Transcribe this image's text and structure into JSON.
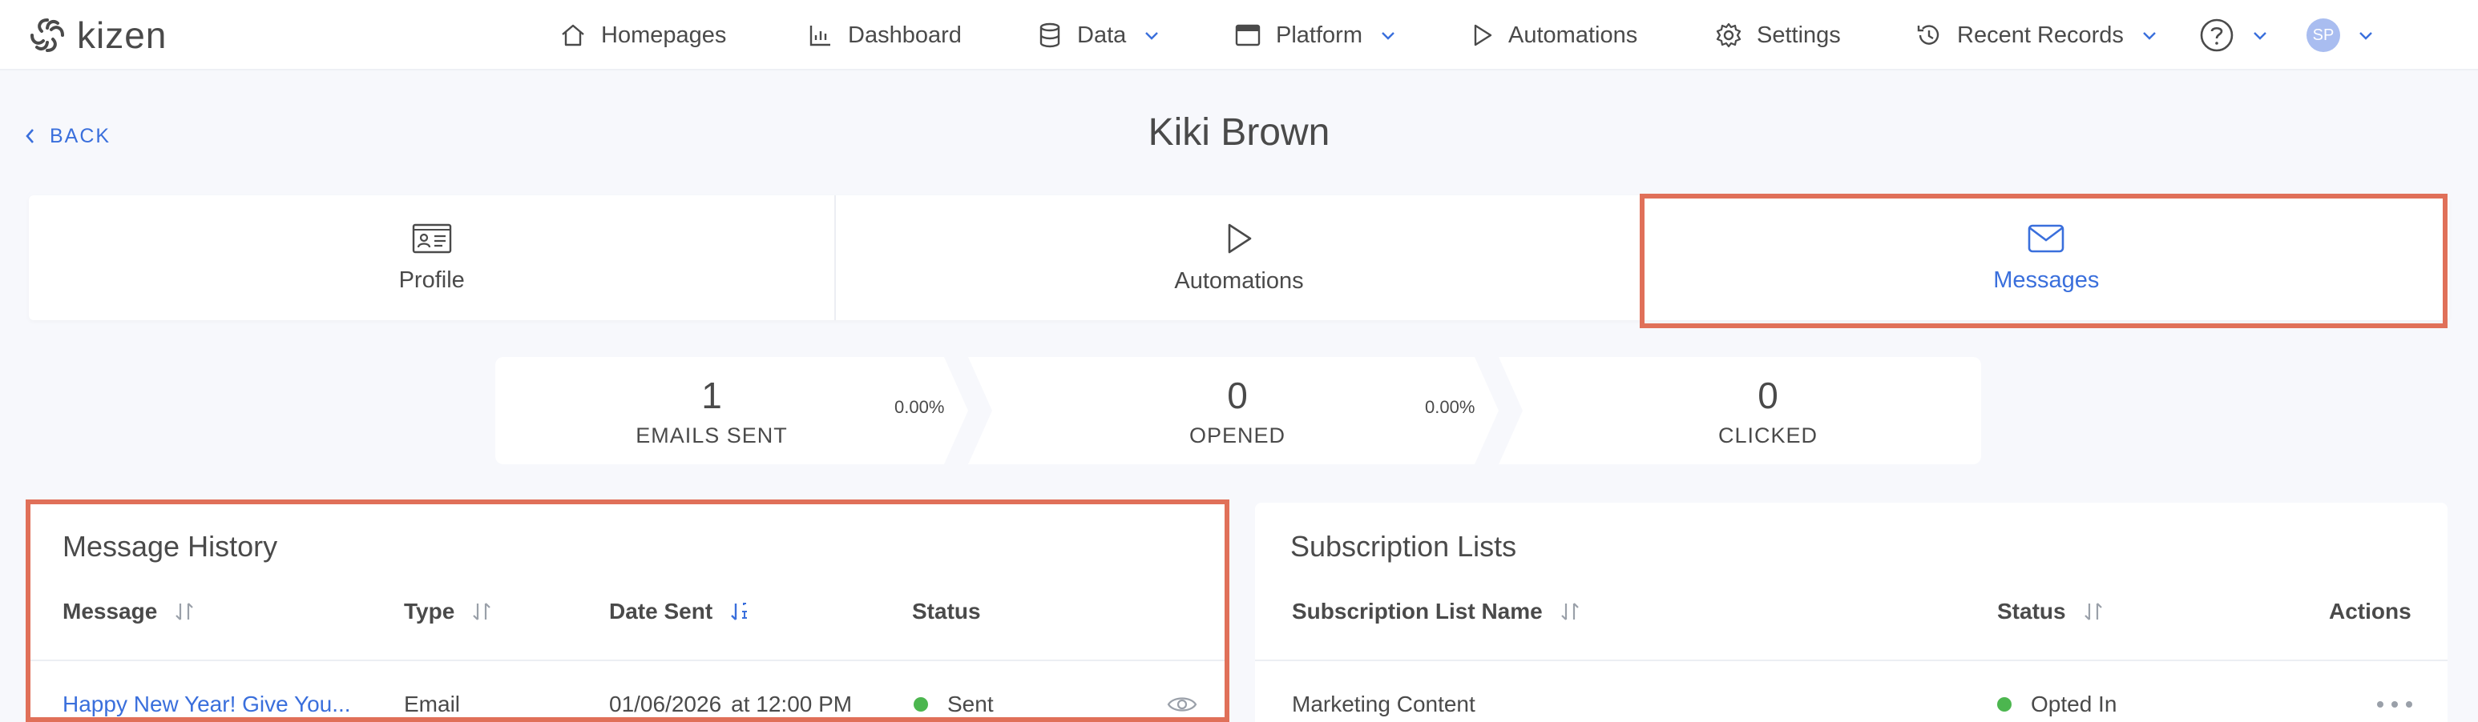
{
  "app": {
    "name": "kizen"
  },
  "nav": {
    "homepages": "Homepages",
    "dashboard": "Dashboard",
    "data": "Data",
    "platform": "Platform",
    "automations": "Automations",
    "settings": "Settings",
    "recent_records": "Recent Records",
    "user_initials": "SP"
  },
  "back_label": "BACK",
  "record_title": "Kiki Brown",
  "tabs": [
    {
      "label": "Profile",
      "icon": "id-card-icon"
    },
    {
      "label": "Automations",
      "icon": "play-icon"
    },
    {
      "label": "Messages",
      "icon": "envelope-icon",
      "active": true
    }
  ],
  "stats": {
    "emails_sent": {
      "value": "1",
      "label": "EMAILS SENT"
    },
    "open_rate": "0.00%",
    "opened": {
      "value": "0",
      "label": "OPENED"
    },
    "click_rate": "0.00%",
    "clicked": {
      "value": "0",
      "label": "CLICKED"
    }
  },
  "message_history": {
    "title": "Message History",
    "columns": [
      "Message",
      "Type",
      "Date Sent",
      "Status"
    ],
    "rows": [
      {
        "message": "Happy New Year! Give You...",
        "type": "Email",
        "date": "01/06/2026",
        "time": "at 12:00 PM",
        "status": "Sent"
      }
    ]
  },
  "subscription_lists": {
    "title": "Subscription Lists",
    "columns": [
      "Subscription List Name",
      "Status",
      "Actions"
    ],
    "rows": [
      {
        "name": "Marketing Content",
        "status": "Opted In"
      }
    ]
  },
  "colors": {
    "accent": "#3a6fdc",
    "highlight": "#e07059",
    "status_green": "#4cb64f"
  }
}
